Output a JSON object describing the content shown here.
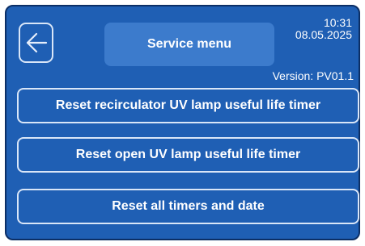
{
  "header": {
    "title": "Service menu",
    "time": "10:31",
    "date": "08.05.2025",
    "version": "Version: PV01.1",
    "back_icon": "back-arrow-icon"
  },
  "actions": [
    {
      "label": "Reset recirculator UV lamp useful life timer"
    },
    {
      "label": "Reset open UV lamp useful life timer"
    },
    {
      "label": "Reset all timers and date"
    }
  ],
  "colors": {
    "background": "#1f5fb4",
    "title_box": "#3c7bcc",
    "outline": "#d9e6f8",
    "text": "#ffffff"
  }
}
